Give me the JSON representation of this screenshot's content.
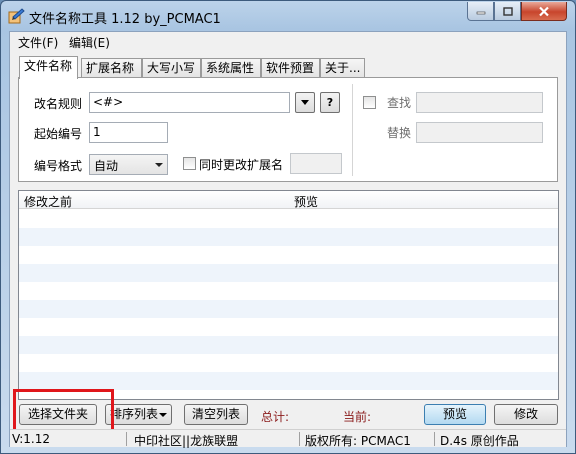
{
  "window": {
    "title": "文件名称工具 1.12  by_PCMAC1"
  },
  "menu": [
    "文件(F)",
    "编辑(E)"
  ],
  "tabs": [
    "文件名称",
    "扩展名称",
    "大写小写",
    "系统属性",
    "软件预置",
    "关于..."
  ],
  "form": {
    "rename_rule_label": "改名规则",
    "rename_rule_value": "<#>",
    "help_label": "?",
    "start_number_label": "起始编号",
    "start_number_value": "1",
    "number_format_label": "编号格式",
    "number_format_value": "自动",
    "change_ext_label": "同时更改扩展名",
    "find_label": "查找",
    "replace_label": "替换"
  },
  "list": {
    "columns": [
      "修改之前",
      "预览"
    ],
    "rows": []
  },
  "buttons": {
    "select_folder": "选择文件夹",
    "sort_list": "排序列表",
    "clear_list": "清空列表",
    "preview": "预览",
    "modify": "修改"
  },
  "stats": {
    "total_label": "总计:",
    "current_label": "当前:"
  },
  "statusbar": {
    "version": "V:1.12",
    "community": "中印社区||龙族联盟",
    "copyright": "版权所有: PCMAC1",
    "original": "D.4s 原创作品"
  },
  "colors": {
    "highlight": "#e0161b",
    "stat_text": "#8a1a1a"
  }
}
